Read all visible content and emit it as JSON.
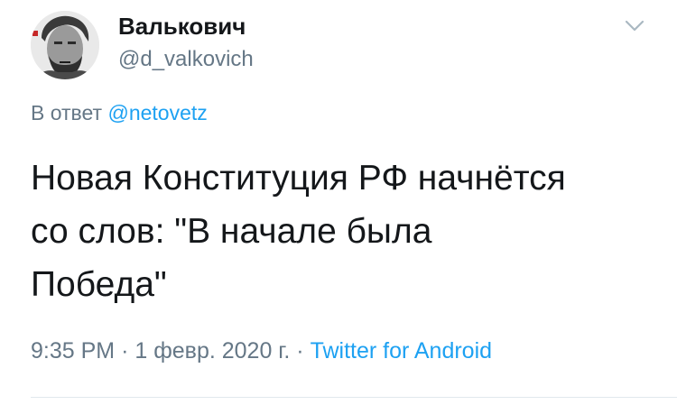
{
  "author": {
    "display_name": "Валькович",
    "handle": "@d_valkovich"
  },
  "reply": {
    "prefix": "В ответ",
    "mention": "@netovetz"
  },
  "tweet": {
    "text": "Новая Конституция РФ начнётся\nсо слов: \"В начале была\nПобеда\""
  },
  "meta": {
    "time": "9:35 PM",
    "sep1": "·",
    "date": "1 февр. 2020 г.",
    "sep2": "·",
    "source": "Twitter for Android"
  },
  "icons": {
    "menu": "chevron-down-icon",
    "avatar": "avatar"
  },
  "colors": {
    "text": "#14171a",
    "secondary": "#657786",
    "link": "#1da1f2",
    "divider": "#e1e8ed"
  }
}
